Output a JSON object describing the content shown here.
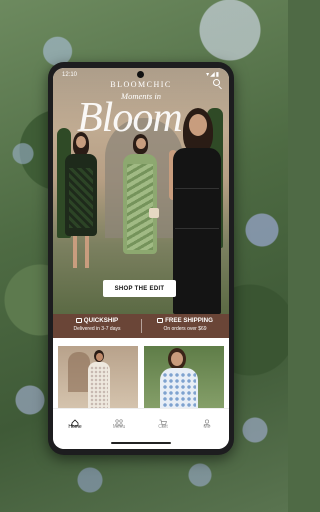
{
  "status_bar": {
    "time": "12:10",
    "icons": "▾◢▮"
  },
  "header": {
    "brand": "BLOOMCHIC"
  },
  "hero": {
    "subtitle": "Moments in",
    "title": "Bloom",
    "cta": "SHOP THE EDIT"
  },
  "promo": [
    {
      "title": "QUICKSHIP",
      "sub": "Delivered in 3-7 days",
      "icon": "truck-icon"
    },
    {
      "title": "FREE SHIPPING",
      "sub": "On orders over $69",
      "icon": "box-icon"
    }
  ],
  "nav": [
    {
      "label": "Home",
      "icon": "home-icon",
      "active": true
    },
    {
      "label": "Menu",
      "icon": "menu-grid-icon",
      "active": false
    },
    {
      "label": "Cart",
      "icon": "cart-icon",
      "active": false
    },
    {
      "label": "Me",
      "icon": "person-icon",
      "active": false
    }
  ],
  "colors": {
    "promo_bar": "#6a4537",
    "accent": "#111111"
  }
}
